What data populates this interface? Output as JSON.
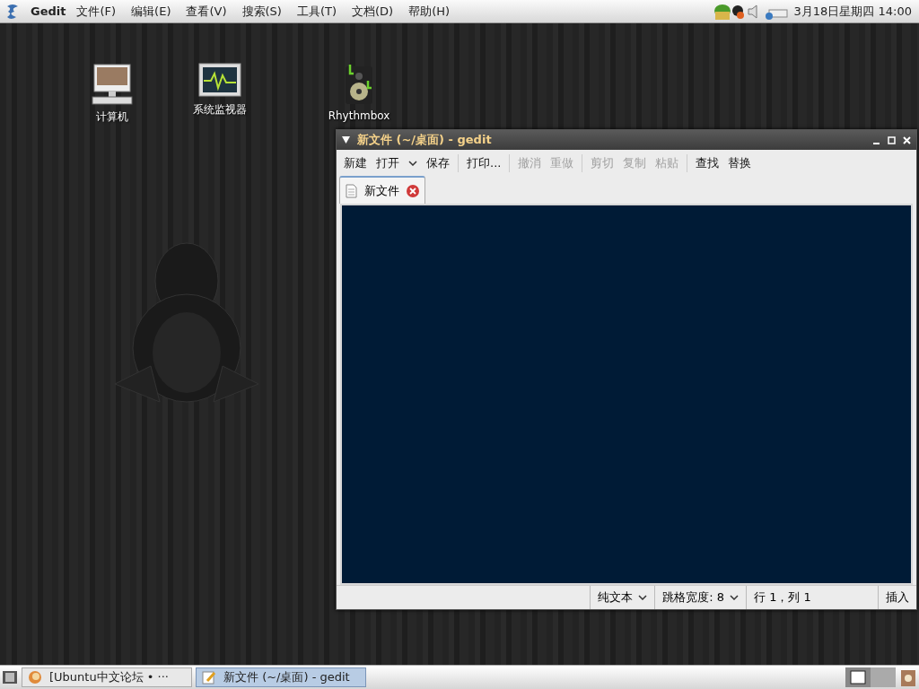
{
  "top_panel": {
    "app_name": "Gedit",
    "menus": [
      "文件(F)",
      "编辑(E)",
      "查看(V)",
      "搜索(S)",
      "工具(T)",
      "文档(D)",
      "帮助(H)"
    ],
    "clock": "3月18日星期四 14:00"
  },
  "desktop_icons": [
    {
      "kind": "computer",
      "label": "计算机"
    },
    {
      "kind": "monitor",
      "label": "系统监视器"
    },
    {
      "kind": "speaker",
      "label": "Rhythmbox"
    }
  ],
  "window": {
    "title": "新文件 (~/桌面) - gedit",
    "toolbar": [
      {
        "kind": "button",
        "label": "新建",
        "disabled": false
      },
      {
        "kind": "menu",
        "label": "打开",
        "disabled": false
      },
      {
        "kind": "button",
        "label": "保存",
        "disabled": false
      },
      {
        "kind": "separator"
      },
      {
        "kind": "button",
        "label": "打印...",
        "disabled": false
      },
      {
        "kind": "separator"
      },
      {
        "kind": "button",
        "label": "撤消",
        "disabled": true
      },
      {
        "kind": "button",
        "label": "重做",
        "disabled": true
      },
      {
        "kind": "separator"
      },
      {
        "kind": "button",
        "label": "剪切",
        "disabled": true
      },
      {
        "kind": "button",
        "label": "复制",
        "disabled": true
      },
      {
        "kind": "button",
        "label": "粘贴",
        "disabled": true
      },
      {
        "kind": "separator"
      },
      {
        "kind": "button",
        "label": "查找",
        "disabled": false
      },
      {
        "kind": "button",
        "label": "替换",
        "disabled": false
      }
    ],
    "tabs": [
      {
        "label": "新文件",
        "selected": true
      }
    ],
    "status_bar": {
      "language": "纯文本",
      "tab_width": "跳格宽度: 8",
      "position": "行 1，列 1",
      "mode": "插入"
    }
  },
  "taskbar": [
    {
      "kind": "browser",
      "label": "[Ubuntu中文论坛 • ···",
      "selected": false
    },
    {
      "kind": "editor",
      "label": "新文件 (~/桌面) - gedit",
      "selected": true
    }
  ]
}
